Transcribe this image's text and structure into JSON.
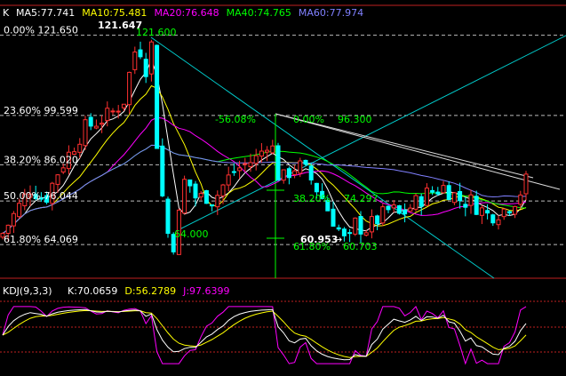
{
  "chart_data": [
    {
      "type": "candlestick",
      "panel": "price",
      "label": "K",
      "ma_legend": [
        {
          "name": "MA5",
          "value": "77.741",
          "color": "#ffffff"
        },
        {
          "name": "MA10",
          "value": "75.481",
          "color": "#ffff00"
        },
        {
          "name": "MA20",
          "value": "76.648",
          "color": "#ff00ff"
        },
        {
          "name": "MA40",
          "value": "74.765",
          "color": "#00ff00"
        },
        {
          "name": "MA60",
          "value": "77.974",
          "color": "#8080ff"
        }
      ],
      "fib_levels": [
        {
          "pct": "0.00%",
          "price": "121.650",
          "value": 121.65
        },
        {
          "pct": "23.60%",
          "price": "99.599",
          "value": 99.599
        },
        {
          "pct": "38.20%",
          "price": "86.020",
          "value": 86.02
        },
        {
          "pct": "50.00%",
          "price": "76.044",
          "value": 76.044
        },
        {
          "pct": "61.80%",
          "price": "64.069",
          "value": 64.069
        }
      ],
      "annotations": {
        "high_marker": "121.647",
        "high_label": "121.600",
        "low_label": "64.000",
        "fan_pct_left": "-56.08%",
        "fan_pct_zero": "0.00%",
        "fan_price_right": "96.300",
        "fan_pct_382": "38.20%",
        "fan_price_382": "74.297",
        "low_marker": "60.953",
        "fan_pct_618": "61.80%",
        "fan_price_618": "60.703"
      },
      "ylim": [
        58,
        124
      ],
      "grid": "dashed horizontal"
    },
    {
      "type": "line",
      "panel": "indicator",
      "title": "KDJ(9,3,3)",
      "legend": [
        {
          "name": "K",
          "value": "70.0659",
          "color": "#ffffff"
        },
        {
          "name": "D",
          "value": "56.2789",
          "color": "#ffff00"
        },
        {
          "name": "J",
          "value": "97.6399",
          "color": "#ff00ff"
        }
      ],
      "ylim": [
        -10,
        110
      ]
    }
  ],
  "colors": {
    "background": "#000000",
    "up": "#ff3030",
    "down": "#00ffff",
    "grid": "#c02020",
    "fib": "#00ff00",
    "trend": "#00ffff"
  }
}
